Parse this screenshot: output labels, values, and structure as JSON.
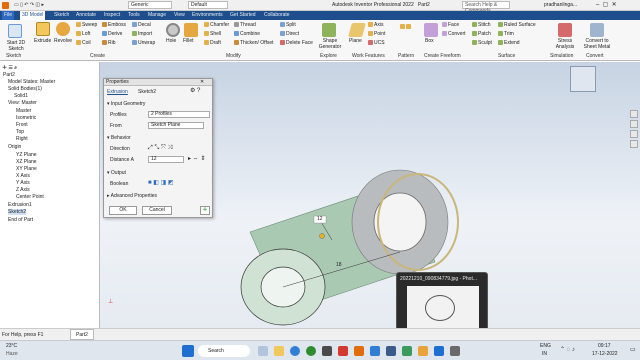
{
  "app": {
    "title": "Autodesk Inventor Professional 2022",
    "doc": "Part2",
    "search_placeholder": "Search Help & Commands...",
    "user": "pradhanlinga...",
    "preset": "Generic",
    "style": "Default"
  },
  "tabs": [
    "File",
    "3D Model",
    "Sketch",
    "Annotate",
    "Inspect",
    "Tools",
    "Manage",
    "View",
    "Environments",
    "Get Started",
    "Collaborate"
  ],
  "ribbon": {
    "sketch": {
      "start": "Start 2D Sketch",
      "group": "Sketch"
    },
    "create": {
      "extrude": "Extrude",
      "revolve": "Revolve",
      "items": [
        "Sweep",
        "Emboss",
        "Decal",
        "Loft",
        "Derive",
        "Import",
        "Coil",
        "Rib",
        "Unwrap"
      ],
      "group": "Create"
    },
    "modify": {
      "hole": "Hole",
      "fillet": "Fillet",
      "items": [
        "Chamfer",
        "Thread",
        "Split",
        "Shell",
        "Combine",
        "Direct",
        "Draft",
        "Thicken/ Offset",
        "Delete Face"
      ],
      "group": "Modify"
    },
    "explore": {
      "shape": "Shape Generator",
      "group": "Explore"
    },
    "work": {
      "plane": "Plane",
      "items": [
        "Axis",
        "Point",
        "UCS"
      ],
      "group": "Work Features"
    },
    "pattern": {
      "group": "Pattern"
    },
    "freeform": {
      "box": "Box",
      "items": [
        "Face",
        "Convert"
      ],
      "group": "Create Freeform"
    },
    "surface": {
      "items": [
        "Stitch",
        "Ruled Surface",
        "Patch",
        "Trim",
        "Sculpt",
        "Extend"
      ],
      "group": "Surface"
    },
    "simulation": {
      "stress": "Stress Analysis",
      "group": "Simulation"
    },
    "convert": {
      "sheet": "Convert to Sheet Metal",
      "group": "Convert"
    }
  },
  "browser": {
    "items": [
      "Part2",
      "Model States: Master",
      "Solid Bodies(1)",
      "Solid1",
      "View: Master",
      "Master",
      "Isometric",
      "Front",
      "Top",
      "Right",
      "Origin",
      "YZ Plane",
      "XZ Plane",
      "XY Plane",
      "X Axis",
      "Y Axis",
      "Z Axis",
      "Center Point",
      "Extrusion1",
      "Sketch2",
      "End of Part"
    ]
  },
  "props": {
    "title": "Properties",
    "feature": "Extrusion",
    "sketch": "Sketch2",
    "sec_input": "Input Geometry",
    "profiles_label": "Profiles",
    "profiles_value": "2 Profiles",
    "from_label": "From",
    "from_value": "Sketch Plane",
    "sec_behavior": "Behavior",
    "direction_label": "Direction",
    "distance_label": "Distance A",
    "distance_value": "12",
    "sec_output": "Output",
    "boolean_label": "Boolean",
    "sec_advanced": "Advanced Properties",
    "ok": "OK",
    "cancel": "Cancel"
  },
  "viewport": {
    "dim_label": "12",
    "dim2": "18"
  },
  "status": {
    "help": "For Help, press F1",
    "doc_tab": "Part2"
  },
  "taskbar": {
    "weather_temp": "23°C",
    "weather_desc": "Haze",
    "search": "Search",
    "lang": "ENG",
    "region": "IN",
    "time": "09:17",
    "date": "17-12-2022"
  },
  "thumbnail": {
    "title": "20221210_090834779.jpg - Phot..."
  }
}
